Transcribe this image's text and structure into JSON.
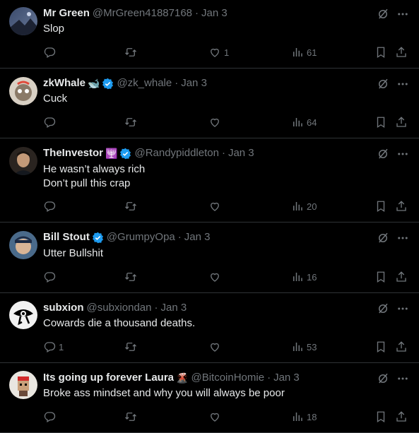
{
  "tweets": [
    {
      "name": "Mr Green",
      "emoji": "",
      "verified": false,
      "handle": "@MrGreen41887168",
      "date": "Jan 3",
      "lines": [
        "Slop"
      ],
      "replies": "",
      "likes": "1",
      "views": "61"
    },
    {
      "name": "zkWhale",
      "emoji": "🐋",
      "verified": true,
      "handle": "@zk_whale",
      "date": "Jan 3",
      "lines": [
        "Cuck"
      ],
      "replies": "",
      "likes": "",
      "views": "64"
    },
    {
      "name": "TheInvestor",
      "emoji": "🕎",
      "verified": true,
      "handle": "@Randypiddleton",
      "date": "Jan 3",
      "lines": [
        "He wasn’t always rich",
        "Don’t pull this crap"
      ],
      "replies": "",
      "likes": "",
      "views": "20"
    },
    {
      "name": "Bill Stout",
      "emoji": "",
      "verified": true,
      "handle": "@GrumpyOpa",
      "date": "Jan 3",
      "lines": [
        "Utter Bullshit"
      ],
      "replies": "",
      "likes": "",
      "views": "16"
    },
    {
      "name": "subxion",
      "emoji": "",
      "verified": false,
      "handle": "@subxiondan",
      "date": "Jan 3",
      "lines": [
        "Cowards die a thousand deaths."
      ],
      "replies": "1",
      "likes": "",
      "views": "53"
    },
    {
      "name": "Its going up forever Laura",
      "emoji": "🌋",
      "verified": false,
      "handle": "@BitcoinHomie",
      "date": "Jan 3",
      "lines": [
        "Broke ass mindset and why you will always be poor"
      ],
      "replies": "",
      "likes": "",
      "views": "18"
    }
  ],
  "colors": {
    "background": "#000000",
    "text": "#e7e9ea",
    "muted": "#71767b",
    "verified": "#1d9bf0",
    "divider": "#2f3336"
  },
  "icons": {
    "reply": "reply-icon",
    "retweet": "retweet-icon",
    "like": "heart-icon",
    "views": "views-icon",
    "bookmark": "bookmark-icon",
    "share": "share-icon",
    "grok": "grok-icon",
    "more": "more-icon"
  }
}
